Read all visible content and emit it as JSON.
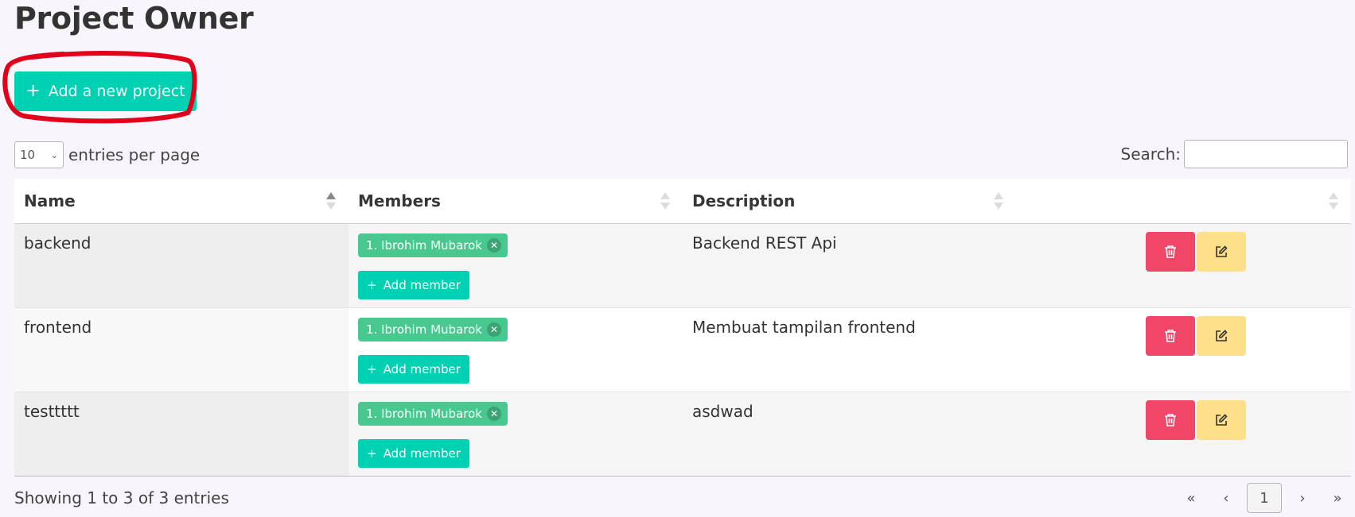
{
  "page": {
    "title": "Project Owner"
  },
  "toolbar": {
    "add_project_label": "Add a new project",
    "add_project_icon": "plus-icon"
  },
  "entries": {
    "per_page_value": "10",
    "label": "entries per page"
  },
  "search": {
    "label": "Search:",
    "value": "",
    "placeholder": ""
  },
  "table": {
    "headers": [
      "Name",
      "Members",
      "Description",
      ""
    ],
    "sorted_column": "Name",
    "rows": [
      {
        "name": "backend",
        "members": [
          "1. Ibrohim Mubarok"
        ],
        "add_member_label": "Add member",
        "description": "Backend REST Api"
      },
      {
        "name": "frontend",
        "members": [
          "1. Ibrohim Mubarok"
        ],
        "add_member_label": "Add member",
        "description": "Membuat tampilan frontend"
      },
      {
        "name": "testtttt",
        "members": [
          "1. Ibrohim Mubarok"
        ],
        "add_member_label": "Add member",
        "description": "asdwad"
      }
    ],
    "row_actions": {
      "delete_icon": "trash-icon",
      "edit_icon": "edit-icon"
    }
  },
  "footer": {
    "info": "Showing 1 to 3 of 3 entries",
    "pagination": {
      "first": "«",
      "prev": "‹",
      "current": "1",
      "next": "›",
      "last": "»"
    }
  },
  "colors": {
    "primary": "#00d1b2",
    "tag": "#48c78e",
    "danger": "#f14668",
    "warning": "#ffe08a",
    "annotation": "#e3001b"
  }
}
